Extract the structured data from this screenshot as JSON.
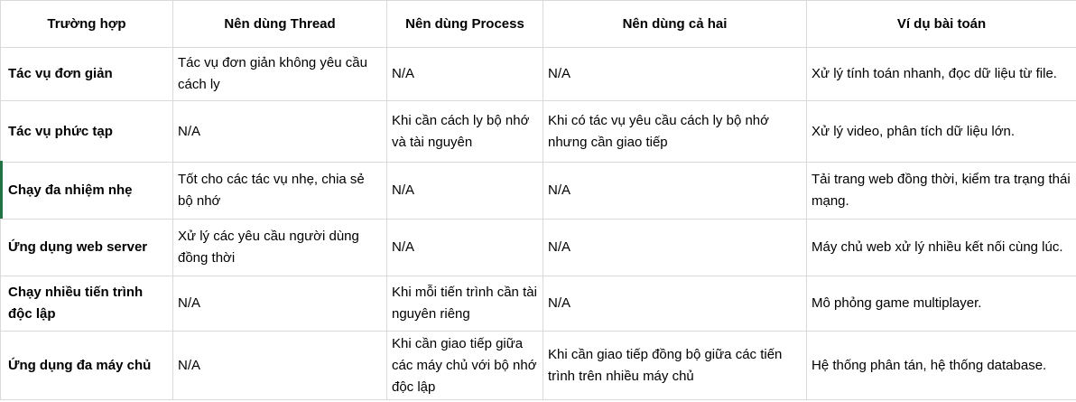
{
  "headers": {
    "case": "Trường hợp",
    "thread": "Nên dùng Thread",
    "process": "Nên dùng Process",
    "both": "Nên dùng cả hai",
    "example": "Ví dụ bài toán"
  },
  "rows": [
    {
      "case": "Tác vụ đơn giản",
      "thread": "Tác vụ đơn giản không yêu cầu cách ly",
      "process": "N/A",
      "both": "N/A",
      "example": "Xử lý tính toán nhanh, đọc dữ liệu từ file."
    },
    {
      "case": "Tác vụ phức tạp",
      "thread": "N/A",
      "process": "Khi cần cách ly bộ nhớ và tài nguyên",
      "both": "Khi có tác vụ yêu cầu cách ly bộ nhớ nhưng cần giao tiếp",
      "example": "Xử lý video, phân tích dữ liệu lớn."
    },
    {
      "case": "Chạy đa nhiệm nhẹ",
      "thread": "Tốt cho các tác vụ nhẹ, chia sẻ bộ nhớ",
      "process": "N/A",
      "both": "N/A",
      "example": "Tải trang web đồng thời, kiểm tra trạng thái mạng."
    },
    {
      "case": "Ứng dụng web server",
      "thread": "Xử lý các yêu cầu người dùng đồng thời",
      "process": "N/A",
      "both": "N/A",
      "example": "Máy chủ web xử lý nhiều kết nối cùng lúc."
    },
    {
      "case": "Chạy nhiều tiến trình độc lập",
      "thread": "N/A",
      "process": "Khi mỗi tiến trình cần tài nguyên riêng",
      "both": "N/A",
      "example": "Mô phỏng game multiplayer."
    },
    {
      "case": "Ứng dụng đa máy chủ",
      "thread": "N/A",
      "process": "Khi cần giao tiếp giữa các máy chủ với bộ nhớ độc lập",
      "both": "Khi cần giao tiếp đồng bộ giữa các tiến trình trên nhiều máy chủ",
      "example": "Hệ thống phân tán, hệ thống database."
    }
  ],
  "colors": {
    "gridline": "#d9d9d9",
    "selection": "#217346"
  }
}
